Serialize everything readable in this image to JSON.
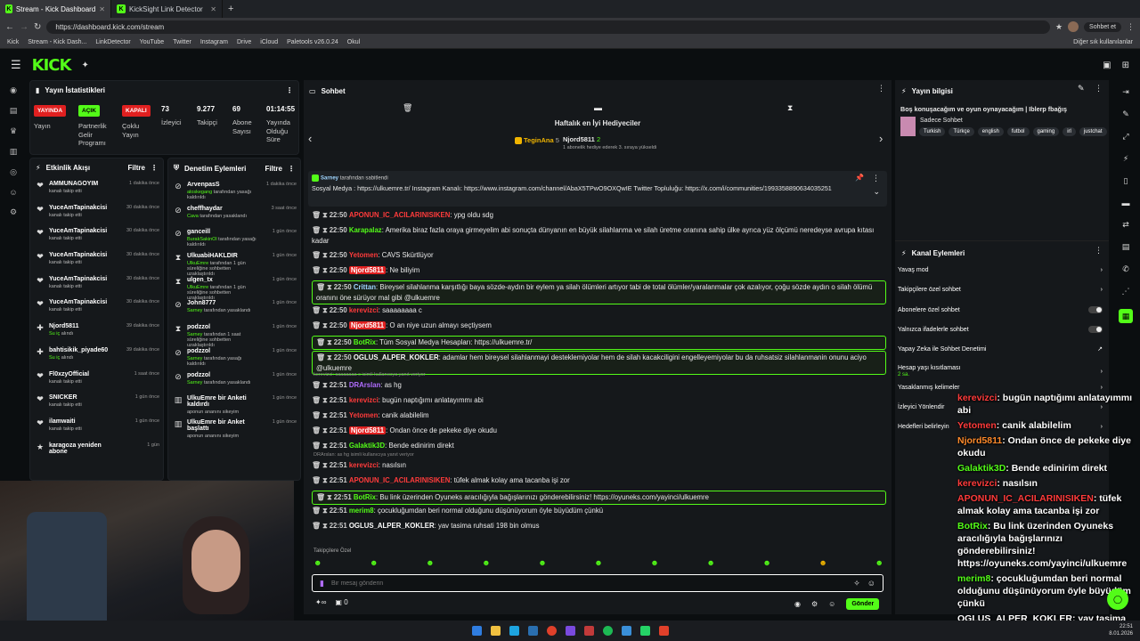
{
  "browser": {
    "tabs": [
      {
        "title": "Stream - Kick Dashboard",
        "active": true
      },
      {
        "title": "KickSight Link Detector",
        "active": false
      }
    ],
    "url": "https://dashboard.kick.com/stream",
    "profile_label": "Sohbet et",
    "bookmarks": [
      "Kick",
      "Stream - Kick Dash...",
      "LinkDetector",
      "YouTube",
      "Twitter",
      "Instagram",
      "Drive",
      "iCloud",
      "Paletools v26.0.24",
      "Okul"
    ],
    "other_bookmarks": "Diğer sık kullanılanlar"
  },
  "header": {
    "logo": "KICK",
    "logo_sup": "BETA"
  },
  "stats": {
    "title": "Yayın İstatistikleri",
    "items": [
      {
        "badge": "YAYINDA",
        "badge_color": "#e02020",
        "label": "Yayın"
      },
      {
        "badge": "AÇIK",
        "badge_color": "#53fc18",
        "label": "Partnerlik Gelir Programı"
      },
      {
        "badge": "KAPALI",
        "badge_color": "#e02020",
        "label": "Çoklu Yayın"
      },
      {
        "value": "73",
        "label": "İzleyici"
      },
      {
        "value": "9.277",
        "label": "Takipçi"
      },
      {
        "value": "69",
        "label": "Abone Sayısı"
      },
      {
        "value": "01:14:55",
        "label": "Yayında Olduğu Süre"
      }
    ]
  },
  "activity": {
    "title": "Etkinlik Akışı",
    "filter": "Filtre",
    "items": [
      {
        "name": "AMMUNAGOYIM",
        "sub": "kanalı takip etti",
        "time": "1 dakika önce",
        "icon": "heart"
      },
      {
        "name": "YuceAmTapinakcisi",
        "sub": "kanalı takip etti",
        "time": "30 dakika önce",
        "icon": "heart"
      },
      {
        "name": "YuceAmTapinakcisi",
        "sub": "kanalı takip etti",
        "time": "30 dakika önce",
        "icon": "heart"
      },
      {
        "name": "YuceAmTapinakcisi",
        "sub": "kanalı takip etti",
        "time": "30 dakika önce",
        "icon": "heart"
      },
      {
        "name": "YuceAmTapinakcisi",
        "sub": "kanalı takip etti",
        "time": "30 dakika önce",
        "icon": "heart"
      },
      {
        "name": "YuceAmTapinakcisi",
        "sub": "kanalı takip etti",
        "time": "30 dakika önce",
        "icon": "heart"
      },
      {
        "name": "Njord5811",
        "sub_hl": "Su iç",
        "sub": "alındı",
        "time": "39 dakika önce",
        "icon": "gift"
      },
      {
        "name": "bahtisikik_piyade60",
        "sub_hl": "Su iç",
        "sub": "alındı",
        "time": "39 dakika önce",
        "icon": "gift"
      },
      {
        "name": "Fl0xzyOfficial",
        "sub": "kanalı takip etti",
        "time": "1 saat önce",
        "icon": "heart"
      },
      {
        "name": "SNICKER",
        "sub": "kanalı takip etti",
        "time": "1 gün önce",
        "icon": "heart"
      },
      {
        "name": "ilamwaiti",
        "sub": "kanalı takip etti",
        "time": "1 gün önce",
        "icon": "heart"
      },
      {
        "name": "karagoza yeniden abone",
        "sub": "",
        "time": "1 gün",
        "icon": "star"
      }
    ]
  },
  "mod": {
    "title": "Denetim Eylemleri",
    "filter": "Filtre",
    "items": [
      {
        "name": "ArvenpasS",
        "actor": "aloskegang",
        "sub": "tarafından yasağı kaldırıldı",
        "time": "1 dakika önce",
        "icon": "ban"
      },
      {
        "name": "cheffhaydar",
        "actor": "Cava",
        "sub": "tarafından yasaklandı",
        "time": "3 saat önce",
        "icon": "ban"
      },
      {
        "name": "ganceill",
        "actor": "BurakSakinOl",
        "sub": "tarafından yasağı kaldırıldı",
        "time": "1 gün önce",
        "icon": "ban"
      },
      {
        "name": "UlkuabiHAKLDIR",
        "actor": "UlkuEmre",
        "sub": "tarafından 1 gün süreliğine sohbetten uzaklaştırıldı",
        "time": "1 gün önce",
        "icon": "hourglass"
      },
      {
        "name": "ulgen_tx",
        "actor": "UlkuEmre",
        "sub": "tarafından 1 gün süreliğine sohbetten uzaklaştırıldı",
        "time": "1 gün önce",
        "icon": "hourglass"
      },
      {
        "name": "John8777",
        "actor": "Sarney",
        "sub": "tarafından yasaklandı",
        "time": "1 gün önce",
        "icon": "ban"
      },
      {
        "name": "podzzol",
        "actor": "Sarney",
        "sub": "tarafından 1 saat süreliğine sohbetten uzaklaştırıldı",
        "time": "1 gün önce",
        "icon": "hourglass"
      },
      {
        "name": "podzzol",
        "actor": "Sarney",
        "sub": "tarafından yasağı kaldırıldı",
        "time": "1 gün önce",
        "icon": "ban"
      },
      {
        "name": "podzzol",
        "actor": "Sarney",
        "sub": "tarafından yasaklandı",
        "time": "1 gün önce",
        "icon": "ban"
      },
      {
        "name": "UlkuEmre bir Anketi kaldırdı",
        "actor": "",
        "sub": "aponun ananını sikeyim",
        "time": "1 gün önce",
        "icon": "poll"
      },
      {
        "name": "UlkuEmre bir Anket başlattı",
        "actor": "",
        "sub": "aponun ananını sikeyim",
        "time": "1 gün önce",
        "icon": "poll"
      }
    ]
  },
  "chat": {
    "title": "Sohbet",
    "weekly_title": "Haftalık en İyi Hediyeciler",
    "gifter1": {
      "name": "TeginAna",
      "count": "5",
      "rank": "1"
    },
    "gifter2": {
      "name": "Njord5811",
      "count": "2",
      "desc": "1 abonelik hediye ederek 3. sıraya yükseldi"
    },
    "pinned_by": "Sarney",
    "pinned_by_suffix": "tarafından sabitlendi",
    "pinned_text": "Sosyal Medya : https://ulkuemre.tr/ Instagram Kanalı: https://www.instagram.com/channel/AbaX5TPwO9OXQwIE Twitter Topluluğu: https://x.com/i/communities/1993358890634035251",
    "messages": [
      {
        "time": "22:50",
        "user": "APONUN_IC_ACILARINISIKEN",
        "color": "red",
        "text": "ypg oldu sdg"
      },
      {
        "time": "22:50",
        "user": "Karapalaz",
        "color": "grn",
        "text": "Amerika biraz fazla oraya girmeyelim abi sonuçta dünyanın en büyük silahlanma ve silah üretme oranına sahip ülke ayrıca yüz ölçümü neredeyse avrupa kıtası kadar"
      },
      {
        "time": "22:50",
        "user": "Yetomen",
        "color": "red",
        "text": "CAVS Skürtlüyor"
      },
      {
        "time": "22:50",
        "user": "Njord5811",
        "color": "pill",
        "text": "Ne biliyim"
      },
      {
        "time": "22:50",
        "user": "Crittan",
        "color": "lt",
        "text": "Bireysel silahlanma karşıtlığı baya sözde-aydın bir eylem ya silah ölümleri artıyor tabi de total ölümler/yaralanmalar çok azalıyor, çoğu sözde aydın o silah ölümü oranını öne sürüyor mal gibi @ulkuemre",
        "highlight": true
      },
      {
        "time": "22:50",
        "user": "kerevizci",
        "color": "red",
        "text": "saaaaaaaa c"
      },
      {
        "time": "22:50",
        "user": "Njord5811",
        "color": "pill",
        "text": "O an niye uzun almayı seçtiysem"
      },
      {
        "time": "22:50",
        "user": "BotRix",
        "color": "grn",
        "text": "Tüm Sosyal Medya Hesapları: https://ulkuemre.tr/",
        "highlight": true
      },
      {
        "time": "22:50",
        "user": "OGLUS_ALPER_KOKLER",
        "color": "wht",
        "text": "adamlar hem bireysel silahlanmayi desteklemiyolar hem de silah kacakciligini engelleyemiyolar bu da ruhsatsiz silahlanmanin onunu aciyo @ulkuemre",
        "highlight": true
      },
      {
        "time": "22:51",
        "user": "DRArslan",
        "color": "pur",
        "text": "as hg",
        "reply": "kerevizci: saaaaaaa c isimli kullanıcıya yanıt veriyor"
      },
      {
        "time": "22:51",
        "user": "kerevizci",
        "color": "red",
        "text": "bugün naptığımı anlatayımmı abi"
      },
      {
        "time": "22:51",
        "user": "Yetomen",
        "color": "red",
        "text": "canik alabilelim"
      },
      {
        "time": "22:51",
        "user": "Njord5811",
        "color": "pill",
        "text": "Ondan önce de pekeke diye okudu"
      },
      {
        "time": "22:51",
        "user": "Galaktik3D",
        "color": "grn",
        "text": "Bende edinirim direkt"
      },
      {
        "time": "22:51",
        "user": "kerevizci",
        "color": "red",
        "text": "nasılsın",
        "reply": "DRArslan: as hg isimli kullanıcıya yanıt veriyor"
      },
      {
        "time": "22:51",
        "user": "APONUN_IC_ACILARINISIKEN",
        "color": "red",
        "text": "tüfek almak kolay ama tacanba işi zor"
      },
      {
        "time": "22:51",
        "user": "BotRix",
        "color": "grn",
        "text": "Bu link üzerinden Oyuneks aracılığıyla bağışlarınızı gönderebilirsiniz! https://oyuneks.com/yayinci/ulkuemre",
        "highlight": true
      },
      {
        "time": "22:51",
        "user": "merim8",
        "color": "grn",
        "text": "çocukluğumdan beri normal olduğunu düşünüyorum öyle büyüdüm çünkü"
      },
      {
        "time": "22:51",
        "user": "OGLUS_ALPER_KOKLER",
        "color": "wht",
        "text": "yav tasima ruhsati 198 bin olmus"
      }
    ],
    "followers_only": "Takipçilere Özel",
    "input_placeholder": "Bir mesaj gönderin",
    "viewer_small": "0",
    "send_label": "Gönder"
  },
  "stream_info": {
    "title": "Yayın bilgisi",
    "stream_title": "Boş konuşacağım ve oyun oynayacağım | Iblerp fbağış",
    "category": "Sadece Sohbet",
    "tags": [
      "Turkish",
      "Türkçe",
      "english",
      "futbol",
      "gaming",
      "irl",
      "justchat"
    ]
  },
  "channel_actions": {
    "title": "Kanal Eylemleri",
    "items": [
      {
        "label": "Yavaş mod",
        "control": "chevron"
      },
      {
        "label": "Takipçilere özel sohbet",
        "control": "chevron"
      },
      {
        "label": "Abonelere özel sohbet",
        "control": "toggle"
      },
      {
        "label": "Yalnızca ifadelerle sohbet",
        "control": "toggle"
      },
      {
        "label": "Yapay Zeka ile Sohbet Denetimi",
        "control": "link"
      },
      {
        "label": "Hesap yaşı kısıtlaması",
        "sub": "2 sa.",
        "control": "chevron"
      },
      {
        "label": "Yasaklanmış kelimeler",
        "control": "chevron"
      },
      {
        "label": "İzleyici Yönlendir",
        "control": "chevron"
      },
      {
        "label": "Hedefleri belirleyin",
        "control": "chevron"
      }
    ]
  },
  "overlay_chat": [
    {
      "user": "kerevizci",
      "color": "#ff3b3b",
      "text": ": bugün naptığımı anlatayımmı abi"
    },
    {
      "user": "Yetomen",
      "color": "#ff3b3b",
      "text": ": canik alabilelim"
    },
    {
      "user": "Njord5811",
      "color": "#ff8a2a",
      "text": ": Ondan önce de pekeke diye okudu"
    },
    {
      "user": "Galaktik3D",
      "color": "#53fc18",
      "text": ": Bende edinirim direkt"
    },
    {
      "user": "kerevizci",
      "color": "#ff3b3b",
      "text": ": nasılsın"
    },
    {
      "user": "APONUN_IC_ACILARINISIKEN",
      "color": "#ff3b3b",
      "text": ": tüfek almak kolay ama tacanba işi zor"
    },
    {
      "user": "BotRix",
      "color": "#53fc18",
      "text": ": Bu link üzerinden Oyuneks aracılığıyla bağışlarınızı gönderebilirsiniz! https://oyuneks.com/yayinci/ulkuemre"
    },
    {
      "user": "merim8",
      "color": "#53fc18",
      "text": ": çocukluğumdan beri normal olduğunu düşünüyorum öyle büyüdüm çünkü"
    },
    {
      "user": "OGLUS_ALPER_KOKLER",
      "color": "#ffffff",
      "text": ": yav tasima ruhsati 198 bin olmus"
    }
  ],
  "taskbar": {
    "time": "22:51",
    "date": "8.01.2026"
  },
  "colors": {
    "accent": "#53fc18",
    "live": "#e02020"
  }
}
